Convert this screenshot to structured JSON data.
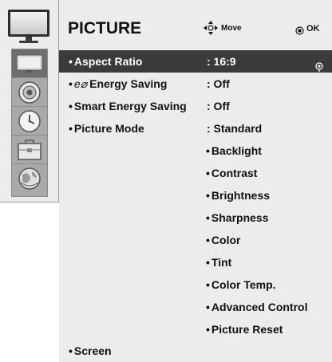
{
  "header": {
    "title": "PICTURE",
    "move_label": "Move",
    "ok_label": "OK"
  },
  "sidebar": {
    "items": [
      {
        "name": "picture-menu",
        "icon": "tv-icon",
        "selected": true
      },
      {
        "name": "audio-menu",
        "icon": "speaker-icon",
        "selected": false
      },
      {
        "name": "time-menu",
        "icon": "clock-icon",
        "selected": false
      },
      {
        "name": "option-menu",
        "icon": "toolbox-icon",
        "selected": false
      },
      {
        "name": "network-menu",
        "icon": "globe-icon",
        "selected": false
      }
    ]
  },
  "menu": {
    "items": [
      {
        "label": "Aspect Ratio",
        "value": ": 16:9",
        "selected": true
      },
      {
        "label": "Energy Saving",
        "eco_prefix": "e⌀",
        "value": ": Off"
      },
      {
        "label": "Smart Energy Saving",
        "value": ": Off"
      },
      {
        "label": "Picture Mode",
        "value": ": Standard"
      }
    ],
    "picture_mode_options": [
      "Backlight",
      "Contrast",
      "Brightness",
      "Sharpness",
      "Color",
      "Tint",
      "Color Temp.",
      "Advanced Control",
      "Picture Reset"
    ],
    "screen_label": "Screen"
  },
  "colors": {
    "panel_bg": "#ececec",
    "selected_row": "#3b3b3b",
    "sidebar_icons_bg": "#a9a9a9"
  }
}
